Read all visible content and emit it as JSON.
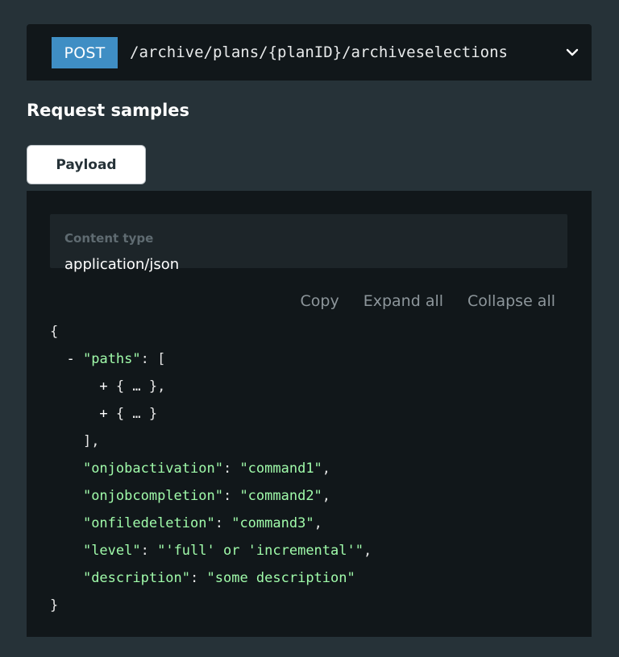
{
  "endpoint": {
    "method": "POST",
    "path": "/archive/plans/{planID}/archiveselections"
  },
  "section_title": "Request samples",
  "tabs": [
    {
      "label": "Payload"
    }
  ],
  "content_type": {
    "label": "Content type",
    "value": "application/json"
  },
  "actions": {
    "copy": "Copy",
    "expand_all": "Expand all",
    "collapse_all": "Collapse all"
  },
  "code": {
    "open_brace": "{",
    "close_brace": "}",
    "collapse_toggle": "-",
    "expand_toggle": "+",
    "paths_key": "\"paths\"",
    "paths_items": [
      "{ … },",
      "{ … }"
    ],
    "paths_close": "],",
    "fields": [
      {
        "key": "\"onjobactivation\"",
        "value": "\"command1\"",
        "sep": ","
      },
      {
        "key": "\"onjobcompletion\"",
        "value": "\"command2\"",
        "sep": ","
      },
      {
        "key": "\"onfiledeletion\"",
        "value": "\"command3\"",
        "sep": ","
      },
      {
        "key": "\"level\"",
        "value": "\"'full' or 'incremental'\"",
        "sep": ","
      },
      {
        "key": "\"description\"",
        "value": "\"some description\"",
        "sep": ""
      }
    ]
  },
  "icons": {
    "chevron": "chevron-down-icon"
  },
  "colors": {
    "background": "#263238",
    "panel": "#11171a",
    "method_badge": "#3f8ec4",
    "json_string": "#a0fbaa"
  }
}
